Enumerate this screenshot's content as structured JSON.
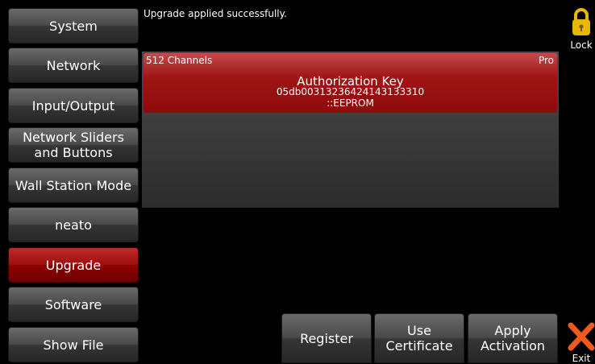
{
  "status_message": "Upgrade applied successfully.",
  "sidebar": {
    "items": [
      {
        "label": "System"
      },
      {
        "label": "Network"
      },
      {
        "label": "Input/Output"
      },
      {
        "label": "Network Sliders\nand Buttons"
      },
      {
        "label": "Wall Station Mode"
      },
      {
        "label": "neato"
      },
      {
        "label": "Upgrade",
        "active": true
      },
      {
        "label": "Software"
      },
      {
        "label": "Show File"
      }
    ]
  },
  "license": {
    "channels": "512 Channels",
    "tier": "Pro",
    "key_title": "Authorization Key",
    "key_value": "05db00313236424143133310",
    "key_source": "::EEPROM"
  },
  "actions": {
    "register": "Register",
    "use_certificate": "Use\nCertificate",
    "apply_activation": "Apply\nActivation"
  },
  "lock": {
    "label": "Lock",
    "icon": "padlock-icon",
    "color": "#e8b800"
  },
  "exit": {
    "label": "Exit",
    "icon": "close-x-icon",
    "color": "#f05a1a"
  },
  "colors": {
    "accent": "#a00f0f",
    "card": "#a01515",
    "button": "#4a4a4a"
  }
}
